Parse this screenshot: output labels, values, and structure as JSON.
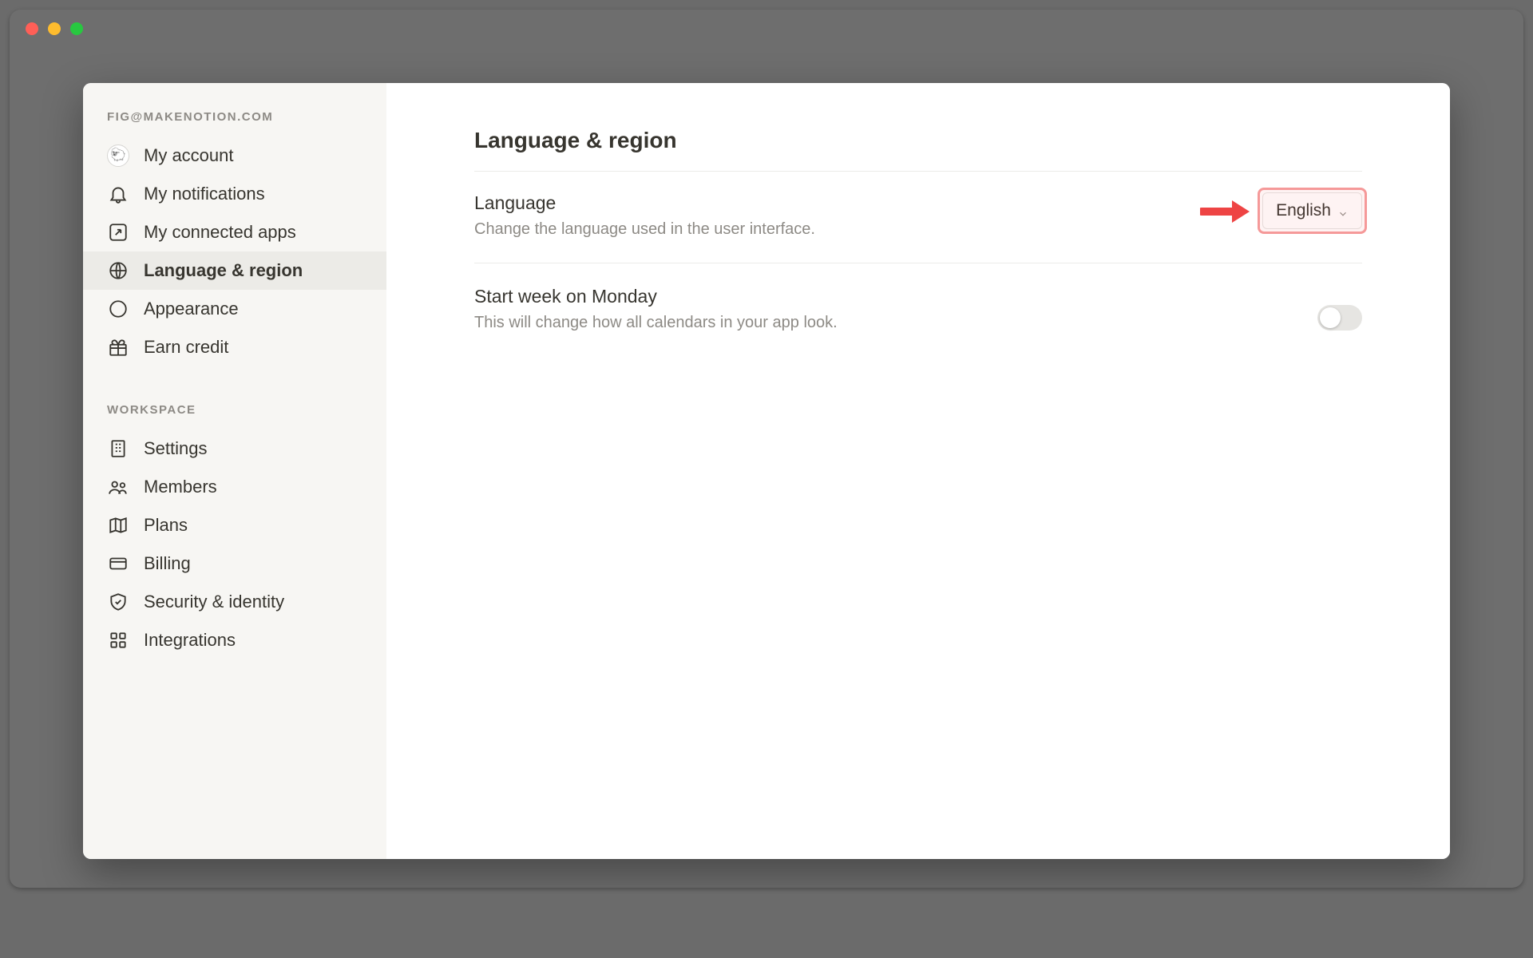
{
  "sidebar": {
    "account_email": "FIG@MAKENOTION.COM",
    "items_account": [
      {
        "label": "My account"
      },
      {
        "label": "My notifications"
      },
      {
        "label": "My connected apps"
      },
      {
        "label": "Language & region"
      },
      {
        "label": "Appearance"
      },
      {
        "label": "Earn credit"
      }
    ],
    "workspace_label": "WORKSPACE",
    "items_workspace": [
      {
        "label": "Settings"
      },
      {
        "label": "Members"
      },
      {
        "label": "Plans"
      },
      {
        "label": "Billing"
      },
      {
        "label": "Security & identity"
      },
      {
        "label": "Integrations"
      }
    ]
  },
  "main": {
    "title": "Language & region",
    "language": {
      "title": "Language",
      "sub": "Change the language used in the user interface.",
      "selected": "English"
    },
    "week": {
      "title": "Start week on Monday",
      "sub": "This will change how all calendars in your app look.",
      "enabled": false
    }
  }
}
